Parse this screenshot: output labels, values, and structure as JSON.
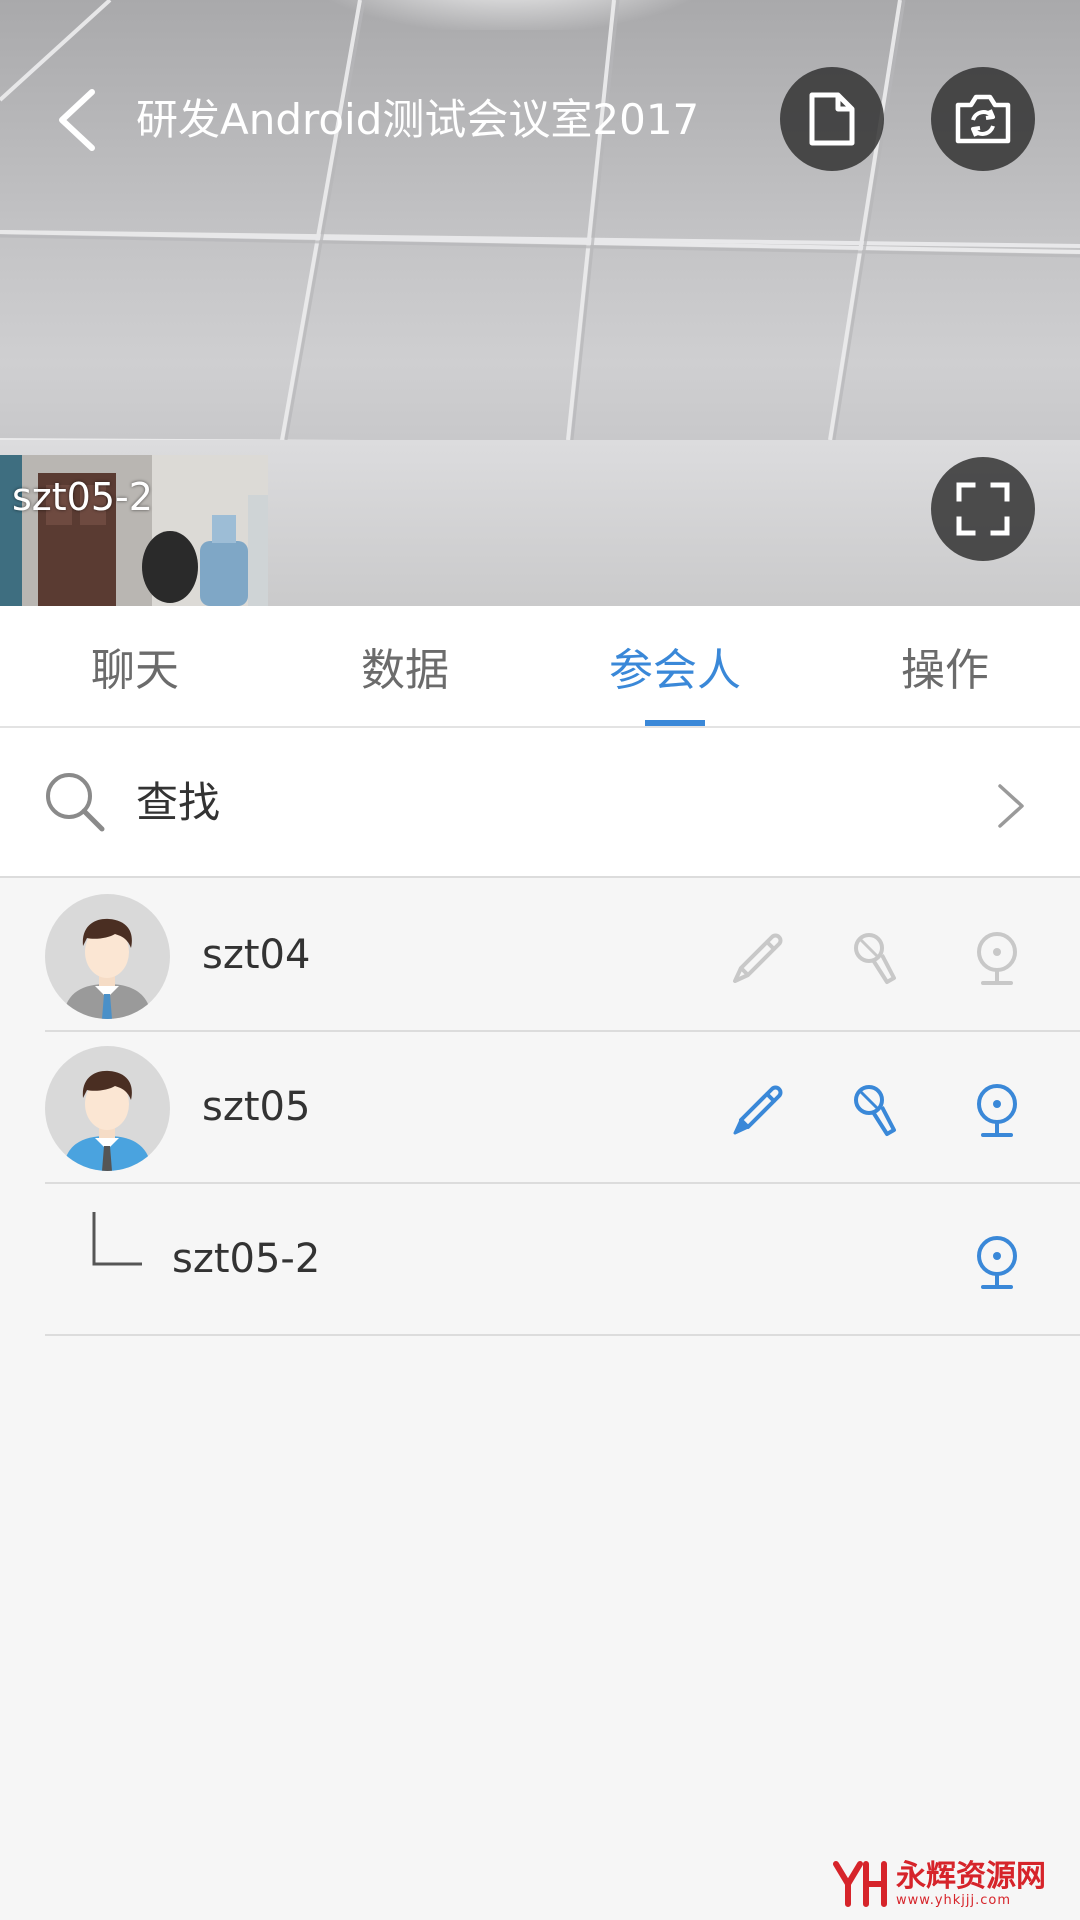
{
  "header": {
    "room_title": "研发Android测试会议室2017"
  },
  "video": {
    "thumbnail_label": "szt05-2"
  },
  "tabs": [
    {
      "label": "聊天",
      "active": false
    },
    {
      "label": "数据",
      "active": false
    },
    {
      "label": "参会人",
      "active": true
    },
    {
      "label": "操作",
      "active": false
    }
  ],
  "search": {
    "label": "查找"
  },
  "participants": [
    {
      "name": "szt04",
      "pen": "inactive",
      "mic": "inactive",
      "camera": "inactive"
    },
    {
      "name": "szt05",
      "pen": "active",
      "mic": "active",
      "camera": "active"
    }
  ],
  "sub_devices": [
    {
      "name": "szt05-2",
      "camera": "active"
    }
  ],
  "colors": {
    "accent": "#3a88d8",
    "inactive_icon": "#c8c8c8",
    "watermark": "#d6242a"
  },
  "icons": {
    "back": "chevron-left-icon",
    "document": "document-icon",
    "switch_camera": "camera-switch-icon",
    "fullscreen": "fullscreen-icon",
    "search": "search-icon",
    "forward": "chevron-right-icon",
    "pen": "pen-icon",
    "mic": "microphone-icon",
    "camera": "webcam-icon"
  },
  "watermark": {
    "text": "永辉资源网",
    "url_text": "www.yhkjjj.com"
  }
}
